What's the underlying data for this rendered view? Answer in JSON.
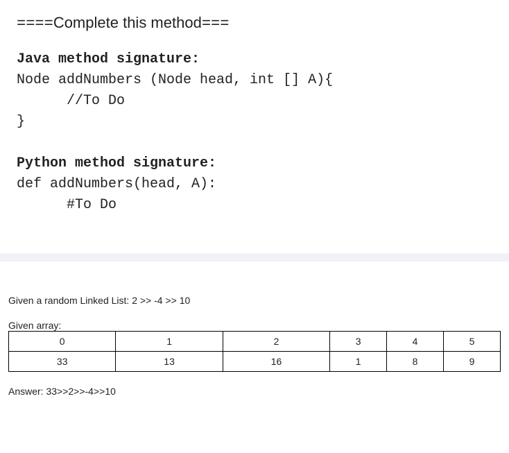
{
  "code": {
    "title_prefix": "====",
    "title_text": "Complete this method",
    "title_suffix": "===",
    "java_label": "Java method signature:",
    "java_line1": "Node addNumbers (Node head, int [] A){",
    "java_line2": "      //To Do",
    "java_line3": "}",
    "python_label": "Python method signature:",
    "python_line1": "def addNumbers(head, A):",
    "python_line2": "      #To Do"
  },
  "example": {
    "given_list": "Given a random Linked List: 2 >> -4 >> 10",
    "given_array_label": "Given array:",
    "table": {
      "headers": [
        "0",
        "1",
        "2",
        "3",
        "4",
        "5"
      ],
      "values": [
        "33",
        "13",
        "16",
        "1",
        "8",
        "9"
      ]
    },
    "answer": "Answer: 33>>2>>-4>>10"
  }
}
